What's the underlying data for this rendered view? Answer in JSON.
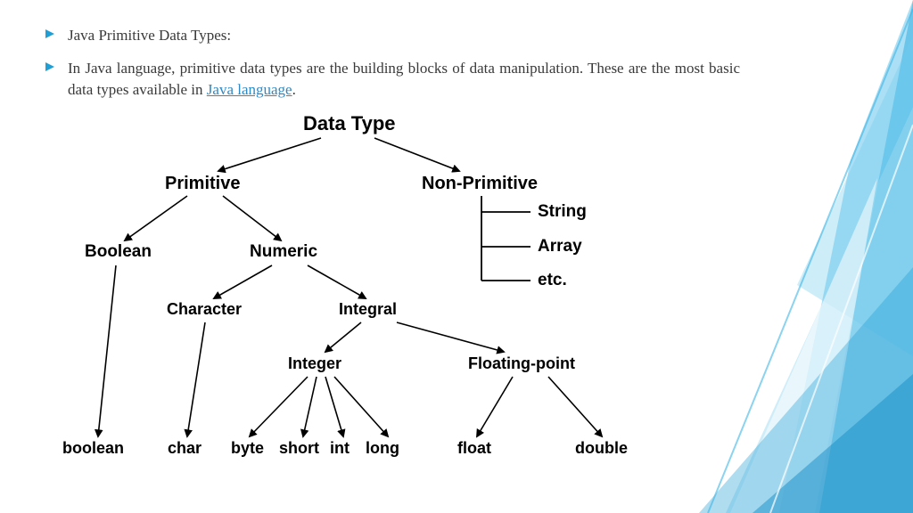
{
  "bullets": {
    "title": "Java Primitive Data Types:",
    "body_pre": "In Java language, primitive data types are the building blocks of data manipulation. These are the most basic data types available in ",
    "link_text": "Java language",
    "body_post": "."
  },
  "tree": {
    "root": "Data Type",
    "primitive": "Primitive",
    "nonprimitive": "Non-Primitive",
    "string": "String",
    "array": "Array",
    "etc": "etc.",
    "boolean_cat": "Boolean",
    "numeric": "Numeric",
    "character": "Character",
    "integral": "Integral",
    "integer": "Integer",
    "floating": "Floating-point",
    "boolean_leaf": "boolean",
    "char": "char",
    "byte": "byte",
    "short": "short",
    "int": "int",
    "long": "long",
    "float": "float",
    "double": "double"
  }
}
